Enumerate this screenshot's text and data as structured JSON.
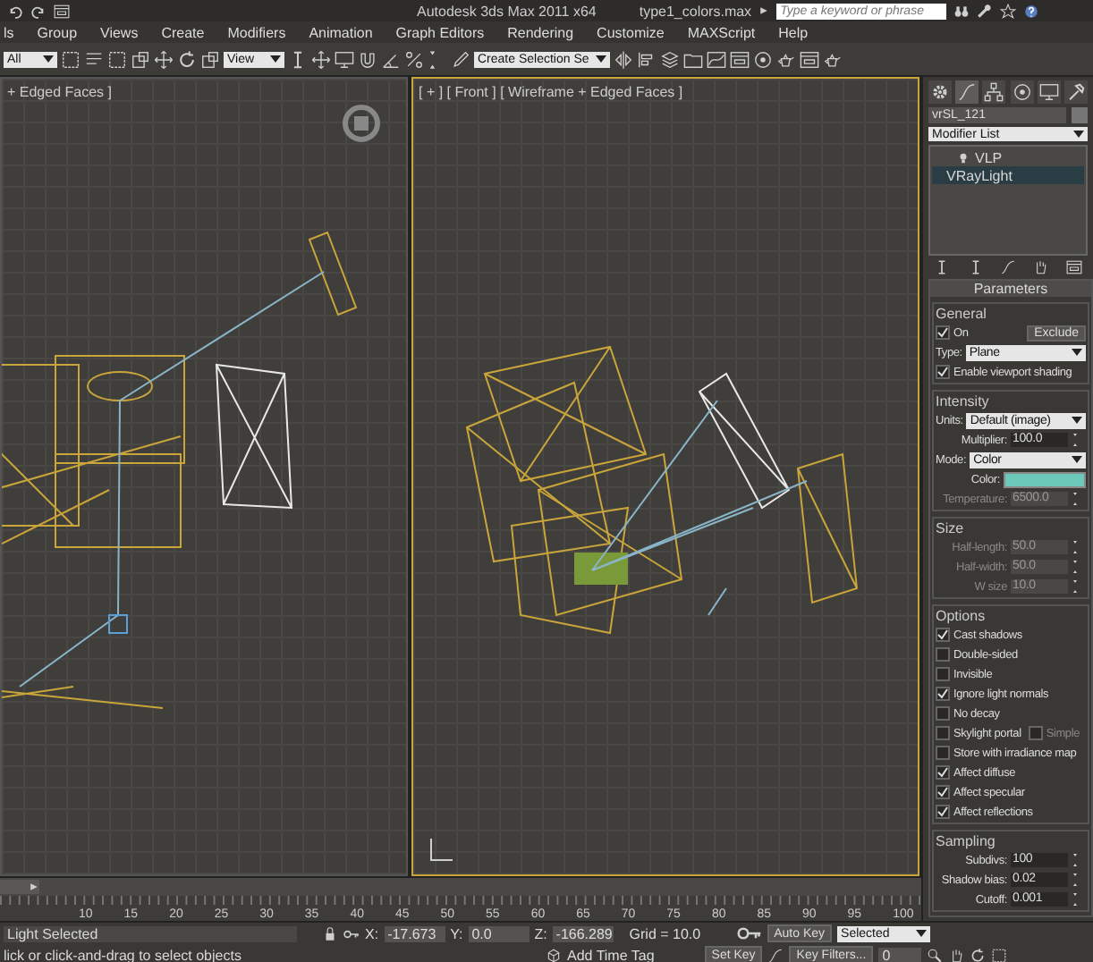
{
  "title_bar": {
    "title": "Autodesk 3ds Max  2011 x64",
    "file": "type1_colors.max",
    "search": {
      "placeholder": "Type a keyword or phrase"
    }
  },
  "menu": [
    "ls",
    "Group",
    "Views",
    "Create",
    "Modifiers",
    "Animation",
    "Graph Editors",
    "Rendering",
    "Customize",
    "MAXScript",
    "Help"
  ],
  "toolbar": {
    "selection_filter": "All",
    "reference_coord": "View",
    "named_selection": "Create Selection Se"
  },
  "viewports": [
    {
      "label": "+ Edged Faces ]",
      "active": false
    },
    {
      "label": "[ + ] [ Front ] [ Wireframe + Edged Faces ]",
      "active": true
    }
  ],
  "command_panel": {
    "object_name": "vrSL_121",
    "modifier_list": "Modifier List",
    "stack": [
      {
        "label": "VLP",
        "selected": false
      },
      {
        "label": "VRayLight",
        "selected": true
      }
    ],
    "rollout": {
      "title": "Parameters",
      "groups": [
        {
          "title": "General",
          "rows": [
            {
              "kind": "checkbox",
              "label": "On",
              "checked": true,
              "button": "Exclude"
            },
            {
              "kind": "dropdown",
              "label": "Type:",
              "value": "Plane"
            },
            {
              "kind": "checkbox",
              "label": "Enable viewport shading",
              "checked": true
            }
          ]
        },
        {
          "title": "Intensity",
          "rows": [
            {
              "kind": "dropdown",
              "label": "Units:",
              "value": "Default (image)"
            },
            {
              "kind": "spinner",
              "label": "Multiplier:",
              "value": "100.0",
              "disabled": false
            },
            {
              "kind": "dropdown",
              "label": "Mode:",
              "value": "Color"
            },
            {
              "kind": "swatch",
              "label": "Color:",
              "color": "#6cc8b8"
            },
            {
              "kind": "spinner",
              "label": "Temperature:",
              "value": "6500.0",
              "disabled": true
            }
          ]
        },
        {
          "title": "Size",
          "rows": [
            {
              "kind": "spinner",
              "label": "Half-length:",
              "value": "50.0",
              "disabled": true
            },
            {
              "kind": "spinner",
              "label": "Half-width:",
              "value": "50.0",
              "disabled": true
            },
            {
              "kind": "spinner",
              "label": "W size",
              "value": "10.0",
              "disabled": true
            }
          ]
        },
        {
          "title": "Options",
          "rows": [
            {
              "kind": "checkbox",
              "label": "Cast shadows",
              "checked": true
            },
            {
              "kind": "checkbox",
              "label": "Double-sided",
              "checked": false
            },
            {
              "kind": "checkbox",
              "label": "Invisible",
              "checked": false
            },
            {
              "kind": "checkbox",
              "label": "Ignore light normals",
              "checked": true
            },
            {
              "kind": "checkbox",
              "label": "No decay",
              "checked": false
            },
            {
              "kind": "checkbox",
              "label": "Skylight portal",
              "checked": false,
              "extra": {
                "label": "Simple",
                "checked": false
              }
            },
            {
              "kind": "checkbox",
              "label": "Store with irradiance map",
              "checked": false
            },
            {
              "kind": "checkbox",
              "label": "Affect diffuse",
              "checked": true
            },
            {
              "kind": "checkbox",
              "label": "Affect specular",
              "checked": true
            },
            {
              "kind": "checkbox",
              "label": "Affect reflections",
              "checked": true
            }
          ]
        },
        {
          "title": "Sampling",
          "rows": [
            {
              "kind": "spinner",
              "label": "Subdivs:",
              "value": "100",
              "disabled": false
            },
            {
              "kind": "spinner",
              "label": "Shadow bias:",
              "value": "0.02",
              "disabled": false
            },
            {
              "kind": "spinner",
              "label": "Cutoff:",
              "value": "0.001",
              "disabled": false
            }
          ]
        }
      ]
    }
  },
  "timeline": {
    "slider": {
      "level": 0
    },
    "ticks": [
      "10",
      "15",
      "20",
      "25",
      "30",
      "35",
      "40",
      "45",
      "50",
      "55",
      "60",
      "65",
      "70",
      "75",
      "80",
      "85",
      "90",
      "95",
      "100"
    ]
  },
  "status_bar": {
    "selection": "Light Selected",
    "coords": [
      {
        "axis": "X:",
        "value": "-17.673"
      },
      {
        "axis": "Y:",
        "value": "0.0"
      },
      {
        "axis": "Z:",
        "value": "-166.289"
      }
    ],
    "grid": "Grid = 10.0",
    "auto_key": "Auto Key",
    "key_mode": "Selected",
    "prompt": "lick or click-and-drag to select objects",
    "time_tag": "Add Time Tag",
    "set_key": "Set Key",
    "key_filters": "Key Filters...",
    "frame": "0"
  }
}
